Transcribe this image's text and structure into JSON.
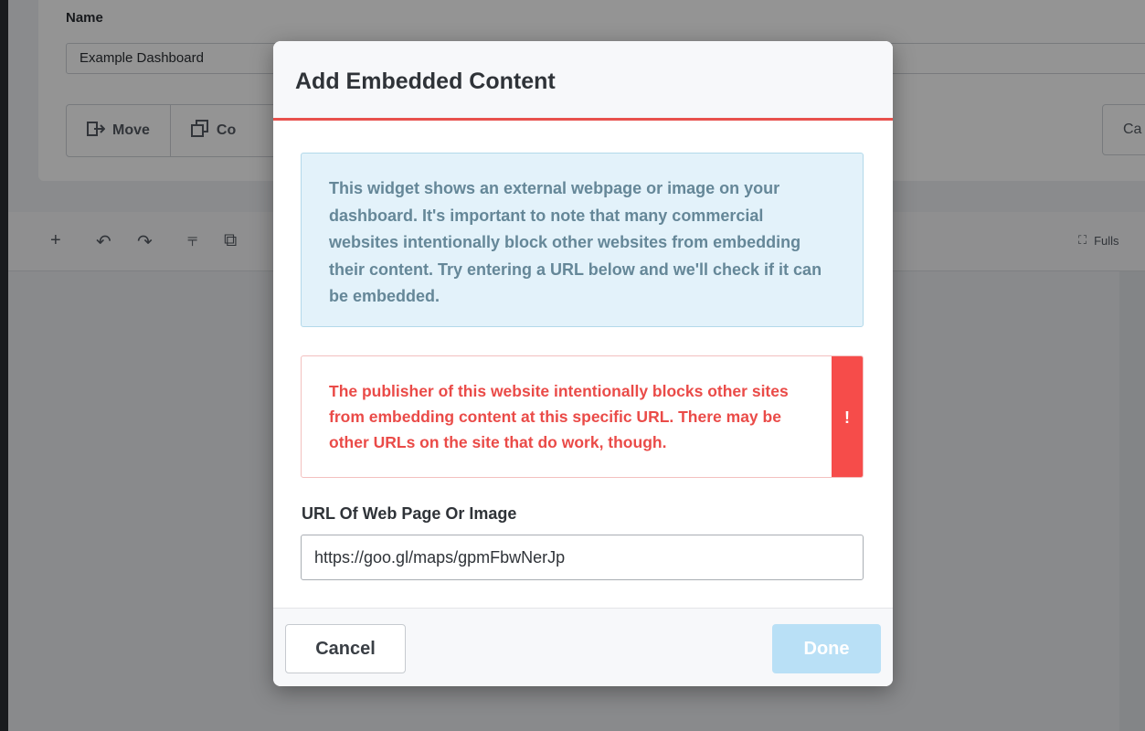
{
  "background": {
    "name_label": "Name",
    "name_value": "Example Dashboard",
    "move_label": "Move",
    "copy_label": "Co",
    "cancel_label": "Ca",
    "fullscreen_label": "Fulls"
  },
  "modal": {
    "title": "Add Embedded Content",
    "info_text": "This widget shows an external webpage or image on your dashboard. It's important to note that many commercial websites intentionally block other websites from embedding their content. Try entering a URL below and we'll check if it can be embedded.",
    "error_text": "The publisher of this website intentionally blocks other sites from embedding content at this specific URL. There may be other URLs on the site that do work, though.",
    "error_badge": "!",
    "url_label": "URL Of Web Page Or Image",
    "url_value": "https://goo.gl/maps/gpmFbwNerJp",
    "cancel_label": "Cancel",
    "done_label": "Done"
  },
  "colors": {
    "accent_red": "#e8504d",
    "info_bg": "#e3f2fa",
    "error_text": "#ea4b48",
    "done_disabled": "#b9e0f6"
  }
}
